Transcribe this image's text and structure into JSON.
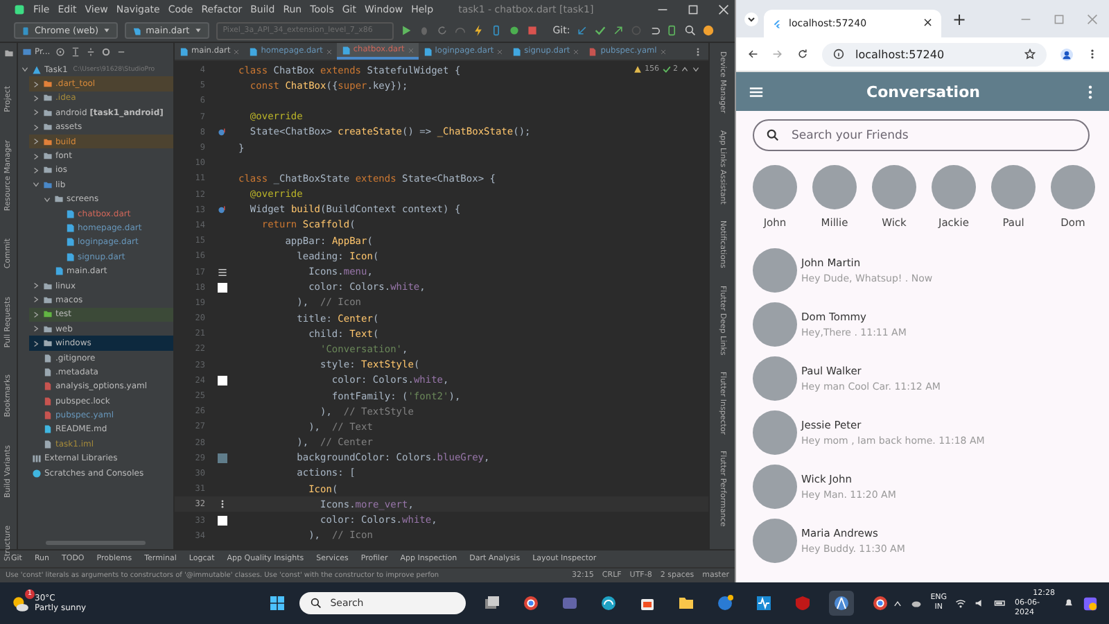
{
  "ide": {
    "menu": [
      "File",
      "Edit",
      "View",
      "Navigate",
      "Code",
      "Refactor",
      "Build",
      "Run",
      "Tools",
      "Git",
      "Window",
      "Help"
    ],
    "title": "task1 - chatbox.dart [task1]",
    "toolbar": {
      "config": "Chrome (web)",
      "run_config": "main.dart",
      "device": "Pixel_3a_API_34_extension_level_7_x86",
      "git_label": "Git:"
    },
    "project_tab": "Pr...",
    "file_tabs": [
      {
        "label": "main.dart",
        "selected": false,
        "color": "#bbbbbb"
      },
      {
        "label": "homepage.dart",
        "selected": false,
        "color": "#6897bb"
      },
      {
        "label": "chatbox.dart",
        "selected": true,
        "color": "#d1675a"
      },
      {
        "label": "loginpage.dart",
        "selected": false,
        "color": "#6897bb"
      },
      {
        "label": "signup.dart",
        "selected": false,
        "color": "#6897bb"
      },
      {
        "label": "pubspec.yaml",
        "selected": false,
        "color": "#6897bb"
      }
    ],
    "left_stripe": [
      "Project",
      "Resource Manager",
      "Commit",
      "Pull Requests",
      "Bookmarks",
      "Build Variants",
      "Structure"
    ],
    "project_tree": [
      {
        "label": "Task1",
        "path": "C:\\Users\\91628\\StudioPro",
        "kind": "module",
        "color": "#bbbbbb",
        "expanded": true,
        "selected": false,
        "children": [
          {
            "label": ".dart_tool",
            "kind": "excluded-folder",
            "color": "#d7893a",
            "expanded": false,
            "selected": false
          },
          {
            "label": ".idea",
            "kind": "folder",
            "color": "#a58a3a",
            "expanded": false,
            "selected": false
          },
          {
            "label": "android **[task1_android]**",
            "kind": "folder",
            "color": "#bbbbbb",
            "expanded": false,
            "selected": false
          },
          {
            "label": "assets",
            "kind": "folder",
            "color": "#bbbbbb",
            "expanded": false,
            "selected": false
          },
          {
            "label": "build",
            "kind": "excluded-folder",
            "color": "#d7893a",
            "expanded": false,
            "selected": false
          },
          {
            "label": "font",
            "kind": "folder",
            "color": "#bbbbbb",
            "expanded": false,
            "selected": false
          },
          {
            "label": "ios",
            "kind": "folder",
            "color": "#bbbbbb",
            "expanded": false,
            "selected": false
          },
          {
            "label": "lib",
            "kind": "source-folder",
            "color": "#bbbbbb",
            "expanded": true,
            "selected": false,
            "children": [
              {
                "label": "screens",
                "kind": "folder",
                "color": "#bbbbbb",
                "expanded": true,
                "selected": false,
                "children": [
                  {
                    "label": "chatbox.dart",
                    "kind": "dart",
                    "color": "#d1675a",
                    "selected": false
                  },
                  {
                    "label": "homepage.dart",
                    "kind": "dart",
                    "color": "#6897bb",
                    "selected": false
                  },
                  {
                    "label": "loginpage.dart",
                    "kind": "dart",
                    "color": "#6897bb",
                    "selected": false
                  },
                  {
                    "label": "signup.dart",
                    "kind": "dart",
                    "color": "#6897bb",
                    "selected": false
                  }
                ]
              },
              {
                "label": "main.dart",
                "kind": "dart",
                "color": "#bbbbbb",
                "selected": false
              }
            ]
          },
          {
            "label": "linux",
            "kind": "folder",
            "color": "#bbbbbb",
            "expanded": false,
            "selected": false
          },
          {
            "label": "macos",
            "kind": "folder",
            "color": "#bbbbbb",
            "expanded": false,
            "selected": false
          },
          {
            "label": "test",
            "kind": "test-folder",
            "color": "#bbbbbb",
            "expanded": false,
            "selected": false
          },
          {
            "label": "web",
            "kind": "folder",
            "color": "#bbbbbb",
            "expanded": false,
            "selected": false
          },
          {
            "label": "windows",
            "kind": "folder",
            "color": "#bbbbbb",
            "expanded": false,
            "selected": true
          },
          {
            "label": ".gitignore",
            "kind": "file",
            "color": "#bbbbbb",
            "selected": false
          },
          {
            "label": ".metadata",
            "kind": "file",
            "color": "#bbbbbb",
            "selected": false
          },
          {
            "label": "analysis_options.yaml",
            "kind": "yaml",
            "color": "#bbbbbb",
            "selected": false
          },
          {
            "label": "pubspec.lock",
            "kind": "yaml",
            "color": "#bbbbbb",
            "selected": false
          },
          {
            "label": "pubspec.yaml",
            "kind": "yaml",
            "color": "#6897bb",
            "selected": false
          },
          {
            "label": "README.md",
            "kind": "md",
            "color": "#bbbbbb",
            "selected": false
          },
          {
            "label": "task1.iml",
            "kind": "file",
            "color": "#a58a3a",
            "selected": false
          }
        ]
      },
      {
        "label": "External Libraries",
        "kind": "libraries",
        "color": "#bbbbbb",
        "selected": false
      },
      {
        "label": "Scratches and Consoles",
        "kind": "scratches",
        "color": "#bbbbbb",
        "selected": false
      }
    ],
    "inspections": {
      "warnings": "156",
      "weak": "2"
    },
    "code_lines": [
      {
        "number": "4",
        "current": false,
        "tokens": [
          {
            "kind": "keyword",
            "text": "class "
          },
          {
            "kind": "plain",
            "text": "ChatBox "
          },
          {
            "kind": "keyword",
            "text": "extends "
          },
          {
            "kind": "plain",
            "text": "StatefulWidget {"
          }
        ]
      },
      {
        "number": "5",
        "current": false,
        "tokens": [
          {
            "kind": "keyword",
            "text": "  const "
          },
          {
            "kind": "function",
            "text": "ChatBox"
          },
          {
            "kind": "plain",
            "text": "({"
          },
          {
            "kind": "keyword",
            "text": "super"
          },
          {
            "kind": "plain",
            "text": ".key});"
          }
        ]
      },
      {
        "number": "6",
        "current": false
      },
      {
        "number": "7",
        "current": false,
        "tokens": [
          {
            "kind": "annotation",
            "text": "  @override"
          }
        ]
      },
      {
        "number": "8",
        "current": false,
        "gutter": {
          "kind": "override"
        },
        "tokens": [
          {
            "kind": "plain",
            "text": "  State<ChatBox> "
          },
          {
            "kind": "function",
            "text": "createState"
          },
          {
            "kind": "plain",
            "text": "() => "
          },
          {
            "kind": "function",
            "text": "_ChatBoxState"
          },
          {
            "kind": "plain",
            "text": "();"
          }
        ]
      },
      {
        "number": "9",
        "current": false,
        "tokens": [
          {
            "kind": "plain",
            "text": "}"
          }
        ]
      },
      {
        "number": "10",
        "current": false
      },
      {
        "number": "11",
        "current": false,
        "tokens": [
          {
            "kind": "keyword",
            "text": "class "
          },
          {
            "kind": "plain",
            "text": "_ChatBoxState "
          },
          {
            "kind": "keyword",
            "text": "extends "
          },
          {
            "kind": "plain",
            "text": "State<ChatBox> {"
          }
        ]
      },
      {
        "number": "12",
        "current": false,
        "tokens": [
          {
            "kind": "annotation",
            "text": "  @override"
          }
        ]
      },
      {
        "number": "13",
        "current": false,
        "gutter": {
          "kind": "override"
        },
        "tokens": [
          {
            "kind": "plain",
            "text": "  Widget "
          },
          {
            "kind": "function",
            "text": "build"
          },
          {
            "kind": "plain",
            "text": "(BuildContext context) {"
          }
        ]
      },
      {
        "number": "14",
        "current": false,
        "tokens": [
          {
            "kind": "keyword",
            "text": "    return "
          },
          {
            "kind": "function",
            "text": "Scaffold"
          },
          {
            "kind": "plain",
            "text": "("
          }
        ]
      },
      {
        "number": "15",
        "current": false,
        "tokens": [
          {
            "kind": "plain",
            "text": "        appBar: "
          },
          {
            "kind": "function",
            "text": "AppBar"
          },
          {
            "kind": "plain",
            "text": "("
          }
        ]
      },
      {
        "number": "16",
        "current": false,
        "tokens": [
          {
            "kind": "plain",
            "text": "          leading: "
          },
          {
            "kind": "function",
            "text": "Icon"
          },
          {
            "kind": "plain",
            "text": "("
          }
        ]
      },
      {
        "number": "17",
        "current": false,
        "gutter": {
          "kind": "menu"
        },
        "tokens": [
          {
            "kind": "plain",
            "text": "            Icons."
          },
          {
            "kind": "constant",
            "text": "menu"
          },
          {
            "kind": "plain",
            "text": ","
          }
        ]
      },
      {
        "number": "18",
        "current": false,
        "gutter": {
          "kind": "swatch",
          "color": "#ffffff"
        },
        "tokens": [
          {
            "kind": "plain",
            "text": "            color: Colors."
          },
          {
            "kind": "constant",
            "text": "white"
          },
          {
            "kind": "plain",
            "text": ","
          }
        ]
      },
      {
        "number": "19",
        "current": false,
        "tokens": [
          {
            "kind": "plain",
            "text": "          ),  "
          },
          {
            "kind": "comment",
            "text": "// Icon"
          }
        ]
      },
      {
        "number": "20",
        "current": false,
        "tokens": [
          {
            "kind": "plain",
            "text": "          title: "
          },
          {
            "kind": "function",
            "text": "Center"
          },
          {
            "kind": "plain",
            "text": "("
          }
        ]
      },
      {
        "number": "21",
        "current": false,
        "tokens": [
          {
            "kind": "plain",
            "text": "            child: "
          },
          {
            "kind": "function",
            "text": "Text"
          },
          {
            "kind": "plain",
            "text": "("
          }
        ]
      },
      {
        "number": "22",
        "current": false,
        "tokens": [
          {
            "kind": "string",
            "text": "              'Conversation'"
          },
          {
            "kind": "plain",
            "text": ","
          }
        ]
      },
      {
        "number": "23",
        "current": false,
        "tokens": [
          {
            "kind": "plain",
            "text": "              style: "
          },
          {
            "kind": "function",
            "text": "TextStyle"
          },
          {
            "kind": "plain",
            "text": "("
          }
        ]
      },
      {
        "number": "24",
        "current": false,
        "gutter": {
          "kind": "swatch",
          "color": "#ffffff"
        },
        "tokens": [
          {
            "kind": "plain",
            "text": "                color: Colors."
          },
          {
            "kind": "constant",
            "text": "white"
          },
          {
            "kind": "plain",
            "text": ","
          }
        ]
      },
      {
        "number": "25",
        "current": false,
        "tokens": [
          {
            "kind": "plain",
            "text": "                fontFamily: ("
          },
          {
            "kind": "string",
            "text": "'font2'"
          },
          {
            "kind": "plain",
            "text": "),"
          }
        ]
      },
      {
        "number": "26",
        "current": false,
        "tokens": [
          {
            "kind": "plain",
            "text": "              ),  "
          },
          {
            "kind": "comment",
            "text": "// TextStyle"
          }
        ]
      },
      {
        "number": "27",
        "current": false,
        "tokens": [
          {
            "kind": "plain",
            "text": "            ),  "
          },
          {
            "kind": "comment",
            "text": "// Text"
          }
        ]
      },
      {
        "number": "28",
        "current": false,
        "tokens": [
          {
            "kind": "plain",
            "text": "          ),  "
          },
          {
            "kind": "comment",
            "text": "// Center"
          }
        ]
      },
      {
        "number": "29",
        "current": false,
        "gutter": {
          "kind": "swatch",
          "color": "#607d8b"
        },
        "tokens": [
          {
            "kind": "plain",
            "text": "          backgroundColor: Colors."
          },
          {
            "kind": "constant",
            "text": "blueGrey"
          },
          {
            "kind": "plain",
            "text": ","
          }
        ]
      },
      {
        "number": "30",
        "current": false,
        "tokens": [
          {
            "kind": "plain",
            "text": "          actions: ["
          }
        ]
      },
      {
        "number": "31",
        "current": false,
        "tokens": [
          {
            "kind": "function",
            "text": "            Icon"
          },
          {
            "kind": "plain",
            "text": "("
          }
        ]
      },
      {
        "number": "32",
        "current": true,
        "gutter": {
          "kind": "more"
        },
        "tokens": [
          {
            "kind": "plain",
            "text": "              Icons."
          },
          {
            "kind": "constant",
            "text": "more_vert"
          },
          {
            "kind": "plain",
            "text": ","
          }
        ]
      },
      {
        "number": "33",
        "current": false,
        "gutter": {
          "kind": "swatch",
          "color": "#ffffff"
        },
        "tokens": [
          {
            "kind": "plain",
            "text": "              color: Colors."
          },
          {
            "kind": "constant",
            "text": "white"
          },
          {
            "kind": "plain",
            "text": ","
          }
        ]
      },
      {
        "number": "34",
        "current": false,
        "tokens": [
          {
            "kind": "plain",
            "text": "            ),  "
          },
          {
            "kind": "comment",
            "text": "// Icon"
          }
        ]
      }
    ],
    "right_stripe": [
      "Device Manager",
      "App Links Assistant",
      "Notifications",
      "Flutter Deep Links",
      "Flutter Inspector",
      "Flutter Performance"
    ],
    "tool_windows": [
      "Git",
      "Run",
      "TODO",
      "Problems",
      "Terminal",
      "Logcat",
      "App Quality Insights",
      "Services",
      "Profiler",
      "App Inspection",
      "Dart Analysis",
      "Layout Inspector"
    ],
    "status_bar": {
      "message": "Use 'const' literals as arguments to constructors of '@immutable' classes. Use 'const' with the constructor to improve perfon",
      "position": "32:15",
      "line_ending": "CRLF",
      "encoding": "UTF-8",
      "indent": "2 spaces",
      "branch": "master"
    }
  },
  "browser": {
    "tab_title": "localhost:57240",
    "tab_close": "×",
    "new_tab": "+",
    "url": "localhost:57240",
    "app": {
      "title": "Conversation",
      "search_placeholder": "Search your Friends",
      "stories": [
        {
          "name": "John"
        },
        {
          "name": "Millie"
        },
        {
          "name": "Wick"
        },
        {
          "name": "Jackie"
        },
        {
          "name": "Paul"
        },
        {
          "name": "Dom"
        }
      ],
      "chats": [
        {
          "name": "John Martin",
          "message": "Hey Dude, Whatsup! . Now"
        },
        {
          "name": "Dom Tommy",
          "message": "Hey,There . 11:11 AM"
        },
        {
          "name": "Paul Walker",
          "message": "Hey man Cool Car. 11:12 AM"
        },
        {
          "name": "Jessie Peter",
          "message": "Hey mom , Iam back home. 11:18 AM"
        },
        {
          "name": "Wick John",
          "message": "Hey Man. 11:20 AM"
        },
        {
          "name": "Maria Andrews",
          "message": "Hey Buddy. 11:30 AM"
        }
      ]
    }
  },
  "taskbar": {
    "weather": {
      "temperature": "30°C",
      "condition": "Partly sunny",
      "badge": "1"
    },
    "search_placeholder": "Search",
    "apps": [
      {
        "kind": "stack",
        "selected": false
      },
      {
        "kind": "ring",
        "selected": false
      },
      {
        "kind": "chat",
        "selected": false
      },
      {
        "kind": "wave",
        "selected": false
      },
      {
        "kind": "bag",
        "selected": false
      },
      {
        "kind": "folder",
        "selected": false
      },
      {
        "kind": "help",
        "selected": false
      },
      {
        "kind": "pulse",
        "selected": false
      },
      {
        "kind": "shield",
        "selected": false
      },
      {
        "kind": "studio",
        "selected": true
      },
      {
        "kind": "ring",
        "selected": false
      }
    ],
    "language": "ENG",
    "region": "IN",
    "time": "12:28",
    "date": "06-06-2024"
  }
}
